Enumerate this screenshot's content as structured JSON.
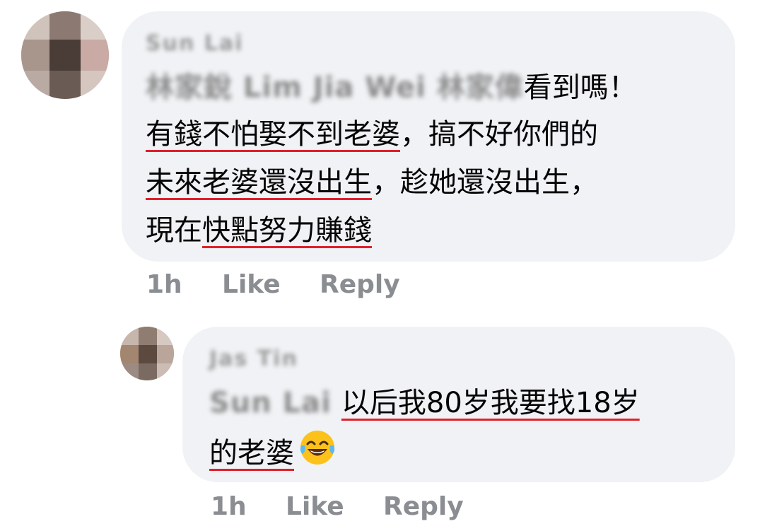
{
  "comments": [
    {
      "author": "Sun Lai",
      "mention": "林家銳 Lim Jia Wei 林家偉",
      "lines": {
        "l1_rest": "看到嗎！",
        "l2_underlined": "有錢不怕娶不到老婆",
        "l2_rest": "，搞不好你們的",
        "l3_underlined": "未來老婆還沒出生",
        "l3_rest": "，趁她還沒出生，",
        "l4_prefix": "現在",
        "l4_underlined": "快點努力賺錢"
      },
      "time": "1h",
      "like_label": "Like",
      "reply_label": "Reply"
    },
    {
      "author": "Jas Tin",
      "mention": "Sun Lai",
      "lines": {
        "l1_underlined": "以后我80岁我要找18岁",
        "l2_underlined": "的老婆"
      },
      "emoji": "tears-of-joy-emoji",
      "time": "1h",
      "like_label": "Like",
      "reply_label": "Reply"
    }
  ],
  "colors": {
    "bubble": "#f0f2f5",
    "underline": "#e0202a",
    "action_text": "#8a8d91"
  }
}
